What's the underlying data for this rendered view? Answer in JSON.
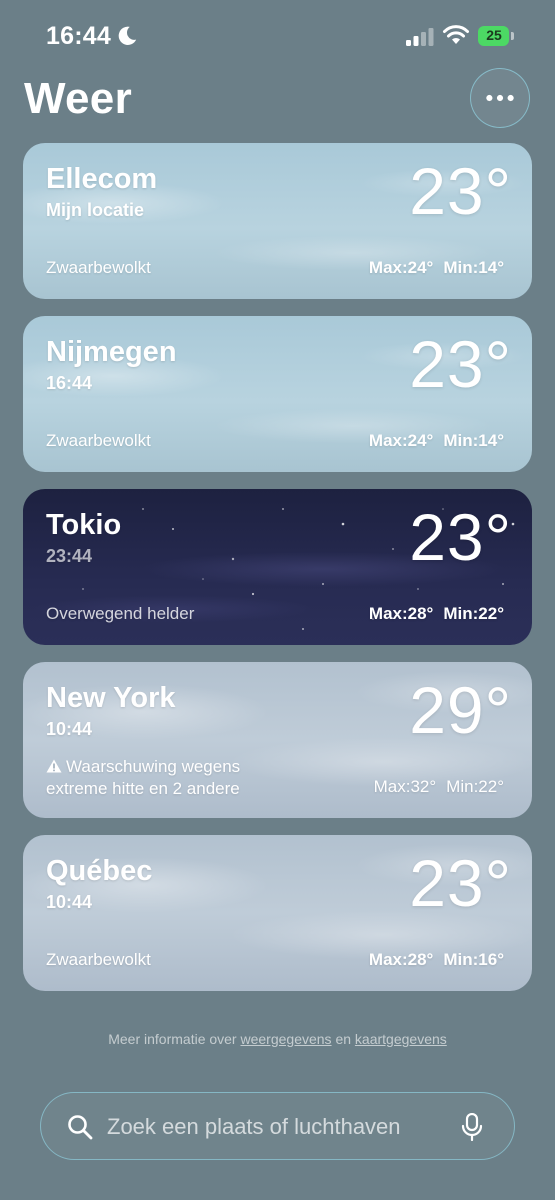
{
  "status": {
    "time": "16:44",
    "battery": "25",
    "battery_color": "#4cd964"
  },
  "header": {
    "title": "Weer",
    "more_icon": "ellipsis-icon"
  },
  "cards": [
    {
      "city": "Ellecom",
      "subtitle": "Mijn locatie",
      "temp": "23°",
      "condition": "Zwaarbewolkt",
      "max": "Max:24°",
      "min": "Min:14°"
    },
    {
      "city": "Nijmegen",
      "subtitle": "16:44",
      "temp": "23°",
      "condition": "Zwaarbewolkt",
      "max": "Max:24°",
      "min": "Min:14°"
    },
    {
      "city": "Tokio",
      "subtitle": "23:44",
      "temp": "23°",
      "condition": "Overwegend helder",
      "max": "Max:28°",
      "min": "Min:22°"
    },
    {
      "city": "New York",
      "subtitle": "10:44",
      "temp": "29°",
      "warning_line1": "Waarschuwing wegens",
      "warning_line2": "extreme hitte en 2 andere",
      "max": "Max:32°",
      "min": "Min:22°"
    },
    {
      "city": "Québec",
      "subtitle": "10:44",
      "temp": "23°",
      "condition": "Zwaarbewolkt",
      "max": "Max:28°",
      "min": "Min:16°"
    }
  ],
  "footer": {
    "info_prefix": "Meer informatie over",
    "weather_link": "weergegevens",
    "joiner": "en",
    "map_link": "kaartgegevens"
  },
  "search": {
    "placeholder": "Zoek een plaats of luchthaven"
  }
}
